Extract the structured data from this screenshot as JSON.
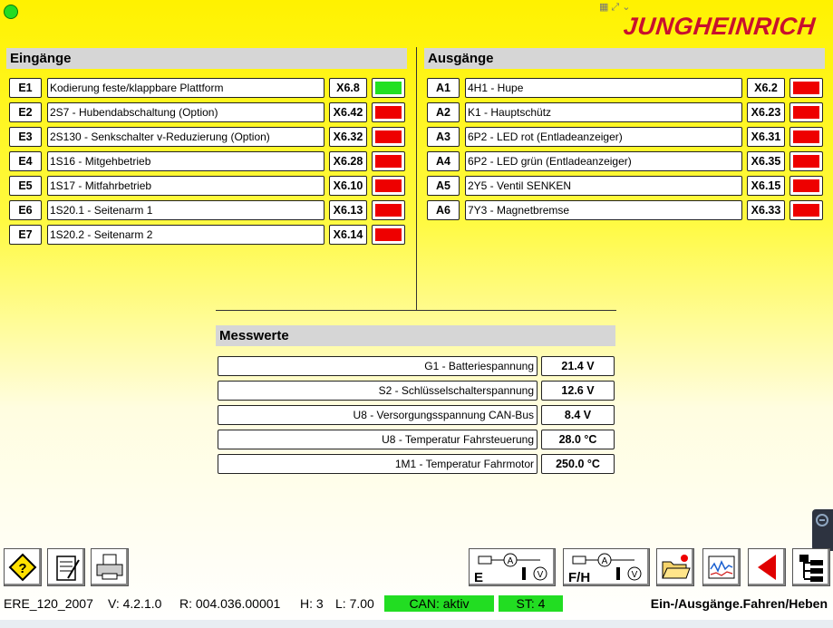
{
  "header": {
    "logo_text": "JUNGHEINRICH",
    "status": "online"
  },
  "eingaenge": {
    "title": "Eingänge",
    "rows": [
      {
        "code": "E1",
        "desc": "Kodierung feste/klappbare Plattform",
        "pin": "X6.8",
        "state": "on"
      },
      {
        "code": "E2",
        "desc": "2S7 - Hubendabschaltung (Option)",
        "pin": "X6.42",
        "state": "off"
      },
      {
        "code": "E3",
        "desc": "2S130 - Senkschalter v-Reduzierung (Option)",
        "pin": "X6.32",
        "state": "off"
      },
      {
        "code": "E4",
        "desc": "1S16 - Mitgehbetrieb",
        "pin": "X6.28",
        "state": "off"
      },
      {
        "code": "E5",
        "desc": "1S17 - Mitfahrbetrieb",
        "pin": "X6.10",
        "state": "off"
      },
      {
        "code": "E6",
        "desc": "1S20.1 - Seitenarm 1",
        "pin": "X6.13",
        "state": "off"
      },
      {
        "code": "E7",
        "desc": "1S20.2 - Seitenarm 2",
        "pin": "X6.14",
        "state": "off"
      }
    ]
  },
  "ausgaenge": {
    "title": "Ausgänge",
    "rows": [
      {
        "code": "A1",
        "desc": " 4H1 - Hupe",
        "pin": "X6.2",
        "state": "off"
      },
      {
        "code": "A2",
        "desc": "K1 - Hauptschütz",
        "pin": "X6.23",
        "state": "off"
      },
      {
        "code": "A3",
        "desc": "6P2 - LED rot (Entladeanzeiger)",
        "pin": "X6.31",
        "state": "off"
      },
      {
        "code": "A4",
        "desc": "6P2 - LED grün (Entladeanzeiger)",
        "pin": "X6.35",
        "state": "off"
      },
      {
        "code": "A5",
        "desc": "2Y5 - Ventil SENKEN",
        "pin": "X6.15",
        "state": "off"
      },
      {
        "code": "A6",
        "desc": "7Y3 - Magnetbremse",
        "pin": "X6.33",
        "state": "off"
      }
    ]
  },
  "messwerte": {
    "title": "Messwerte",
    "rows": [
      {
        "label": "G1 - Batteriespannung",
        "value": "21.4 V"
      },
      {
        "label": "S2 - Schlüsselschalterspannung",
        "value": "12.6 V"
      },
      {
        "label": "U8 - Versorgungsspannung CAN-Bus",
        "value": "8.4 V"
      },
      {
        "label": "U8 - Temperatur Fahrsteuerung",
        "value": "28.0 °C"
      },
      {
        "label": "1M1 - Temperatur Fahrmotor",
        "value": "250.0 °C"
      }
    ]
  },
  "colors": {
    "on": "#22e022",
    "off": "#ee0000"
  },
  "toolbar": {
    "left": [
      "help-icon",
      "notepad-icon",
      "printer-icon"
    ],
    "e_button_label": "E",
    "fh_button_label": "F/H",
    "right": [
      "folder-icon",
      "graph-icon",
      "back-icon",
      "tree-icon"
    ]
  },
  "statusbar": {
    "model": "ERE_120_2007",
    "version": "V: 4.2.1.0",
    "revision": "R: 004.036.00001",
    "h": "H: 3",
    "l": "L: 7.00",
    "can": "CAN: aktiv",
    "st": "ST: 4",
    "screen": "Ein-/Ausgänge.Fahren/Heben"
  }
}
